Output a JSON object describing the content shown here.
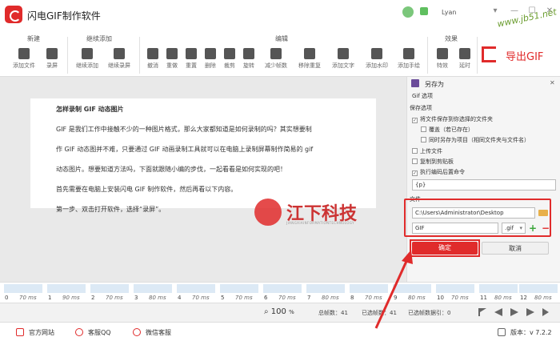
{
  "app": {
    "title": "闪电GIF制作软件",
    "username": "Lyan",
    "watermark": "www.jb51.net"
  },
  "ribbon": {
    "groups": [
      {
        "label": "新建",
        "buttons": [
          "添加文件",
          "录屏"
        ]
      },
      {
        "label": "继续添加",
        "buttons": [
          "继续添加",
          "继续录屏"
        ]
      },
      {
        "label": "编辑",
        "buttons": [
          "撤消",
          "重做",
          "重置",
          "删除",
          "裁剪",
          "旋转",
          "减少帧数",
          "移除重复",
          "添加文字",
          "添加水印",
          "添加手绘"
        ]
      },
      {
        "label": "效果",
        "buttons": [
          "特效",
          "延时"
        ]
      }
    ],
    "export_label": "导出GIF"
  },
  "document": {
    "lines": [
      "怎样录制 GIF 动态图片",
      "GIF 是我们工作中接触不少的一种图片格式，那么大家都知道是如何录制的吗？其实想要制",
      "作 GIF 动态图并不难，只要通过 GIF 动画录制工具就可以在电脑上录制屏幕制作简易的 gif",
      "动态图片。想要知道方法吗，下面就跟随小编的步伐，一起看看是如何实现的吧！",
      "首先需要在电脑上安装闪电 GIF 制作软件，然后再看以下内容。",
      "第一步、双击打开软件，选择“录屏”。"
    ]
  },
  "brand_watermark": {
    "name": "江下科技",
    "sub": "JIANGXIAINFORMATIONTECHNOLOGY"
  },
  "panel": {
    "header": "另存为",
    "gif_options": "Gif 选项",
    "save_options": "保存选项",
    "options": [
      {
        "label": "将文件保存到你选择的文件夹",
        "checked": true
      },
      {
        "label": "覆盖（若已存在）",
        "checked": false
      },
      {
        "label": "同时另存为项目（相同文件夹与文件名）",
        "checked": false
      },
      {
        "label": "上传文件",
        "checked": false
      },
      {
        "label": "复制到剪贴板",
        "checked": false
      },
      {
        "label": "执行编码后置命令",
        "checked": true
      }
    ],
    "command_value": "{p}",
    "file_label": "文件",
    "folder_value": "C:\\Users\\Administrator\\Desktop",
    "filename_value": "GIF",
    "extension_value": ".gif",
    "ok_label": "确定",
    "cancel_label": "取消"
  },
  "frames": [
    {
      "index": "0",
      "ms": "70 ms"
    },
    {
      "index": "1",
      "ms": "90 ms"
    },
    {
      "index": "2",
      "ms": "70 ms"
    },
    {
      "index": "3",
      "ms": "80 ms"
    },
    {
      "index": "4",
      "ms": "70 ms"
    },
    {
      "index": "5",
      "ms": "70 ms"
    },
    {
      "index": "6",
      "ms": "70 ms"
    },
    {
      "index": "7",
      "ms": "80 ms"
    },
    {
      "index": "8",
      "ms": "70 ms"
    },
    {
      "index": "9",
      "ms": "80 ms"
    },
    {
      "index": "10",
      "ms": "70 ms"
    },
    {
      "index": "11",
      "ms": "80 ms"
    },
    {
      "index": "12",
      "ms": "80 ms"
    }
  ],
  "status": {
    "zoom_value": "100",
    "zoom_unit": "%",
    "total_frames": "总帧数：41",
    "selected_frames": "已选帧数：41",
    "selected_count": "已选帧数据引：0"
  },
  "footer": {
    "official_site": "官方网站",
    "qq_service": "客服QQ",
    "wechat_service": "微信客服",
    "version": "版本：v 7.2.2"
  },
  "colors": {
    "accent": "#e02b2b"
  }
}
